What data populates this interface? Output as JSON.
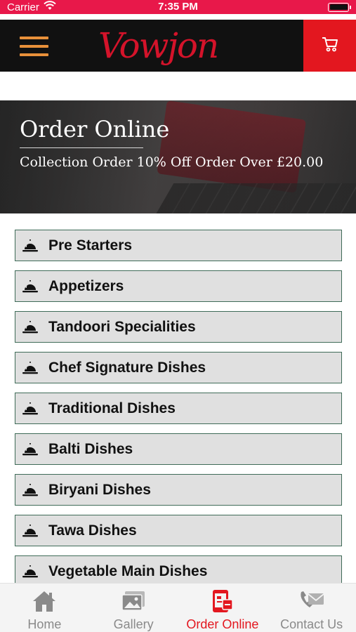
{
  "status_bar": {
    "carrier": "Carrier",
    "time": "7:35 PM"
  },
  "header": {
    "brand": "Vowjon",
    "menu_icon": "hamburger-menu-icon",
    "cart_icon": "cart-icon"
  },
  "hero": {
    "title": "Order Online",
    "subtitle": "Collection Order 10% Off Order Over £20.00"
  },
  "categories": [
    {
      "label": "Pre Starters",
      "icon": "cloche-icon"
    },
    {
      "label": "Appetizers",
      "icon": "cloche-icon"
    },
    {
      "label": "Tandoori Specialities",
      "icon": "cloche-icon"
    },
    {
      "label": "Chef Signature Dishes",
      "icon": "cloche-icon"
    },
    {
      "label": "Traditional Dishes",
      "icon": "cloche-icon"
    },
    {
      "label": "Balti Dishes",
      "icon": "cloche-icon"
    },
    {
      "label": "Biryani Dishes",
      "icon": "cloche-icon"
    },
    {
      "label": "Tawa Dishes",
      "icon": "cloche-icon"
    },
    {
      "label": "Vegetable Main Dishes",
      "icon": "cloche-icon"
    }
  ],
  "tabs": [
    {
      "label": "Home",
      "icon": "home-icon",
      "active": false
    },
    {
      "label": "Gallery",
      "icon": "gallery-icon",
      "active": false
    },
    {
      "label": "Order Online",
      "icon": "order-online-icon",
      "active": true
    },
    {
      "label": "Contact Us",
      "icon": "contact-icon",
      "active": false
    }
  ],
  "colors": {
    "status_bar": "#e8184a",
    "header_bg": "#111111",
    "accent_red": "#e3171f",
    "menu_orange": "#e8903a",
    "list_item_bg": "#e0e0e0",
    "list_item_border": "#3f6b58"
  }
}
